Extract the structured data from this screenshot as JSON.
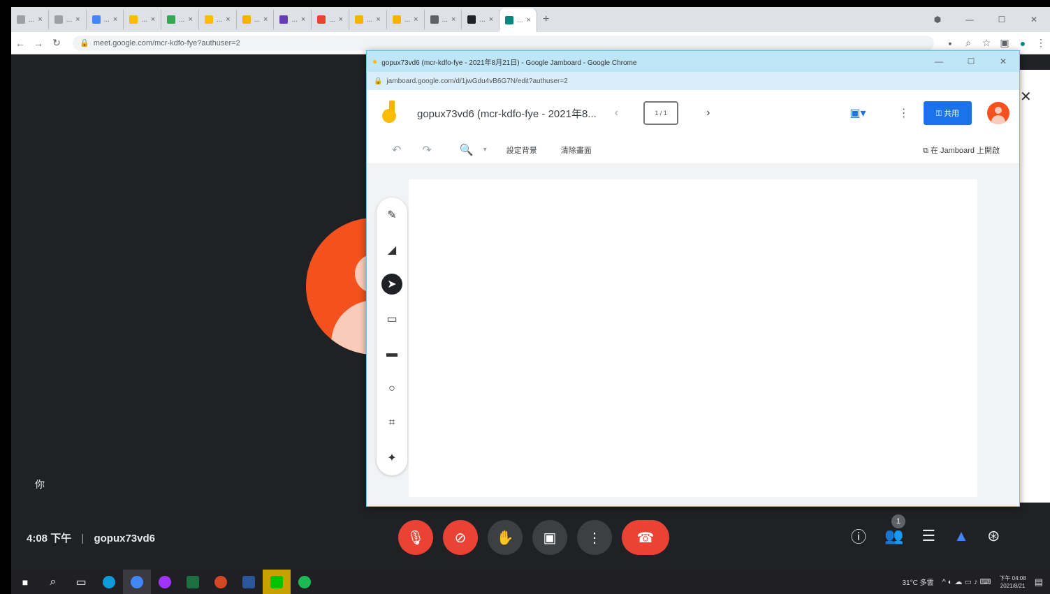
{
  "browser": {
    "tabs": [
      {
        "label": "...",
        "color": "#9aa0a6"
      },
      {
        "label": "...",
        "color": "#9aa0a6"
      },
      {
        "label": "...",
        "color": "#4285f4"
      },
      {
        "label": "...",
        "color": "#fbbc04"
      },
      {
        "label": "...",
        "color": "#34a853"
      },
      {
        "label": "...",
        "color": "#fbbc04"
      },
      {
        "label": "...",
        "color": "#f4b400"
      },
      {
        "label": "...",
        "color": "#673ab7"
      },
      {
        "label": "...",
        "color": "#ea4335"
      },
      {
        "label": "...",
        "color": "#f4b400"
      },
      {
        "label": "...",
        "color": "#f4b400"
      },
      {
        "label": "...",
        "color": "#5f6368"
      },
      {
        "label": "...",
        "color": "#202124"
      },
      {
        "label": "...",
        "color": "#00897b",
        "active": true
      }
    ],
    "url": "meet.google.com/mcr-kdfo-fye?authuser=2"
  },
  "popup": {
    "window_title": "gopux73vd6 (mcr-kdfo-fye - 2021年8月21日) - Google Jamboard - Google Chrome",
    "url": "jamboard.google.com/d/1jwGdu4vB6G7N/edit?authuser=2",
    "doc_title": "gopux73vd6 (mcr-kdfo-fye - 2021年8...",
    "frame_indicator": "1 / 1",
    "share_label": "共用",
    "toolbar_items": [
      "設定背景",
      "清除畫面"
    ],
    "open_in_jamboard": "在 Jamboard 上開啟"
  },
  "meet": {
    "self_label": "你",
    "time": "4:08 下午",
    "meeting_code": "gopux73vd6",
    "participant_count": "1"
  },
  "taskbar": {
    "weather": "31°C 多雲",
    "clock_time": "下午 04:08",
    "clock_date": "2021/8/21"
  },
  "colors": {
    "meet_bg": "#202124",
    "avatar": "#f4511e",
    "danger": "#ea4335",
    "share_button": "#1a73e8"
  }
}
